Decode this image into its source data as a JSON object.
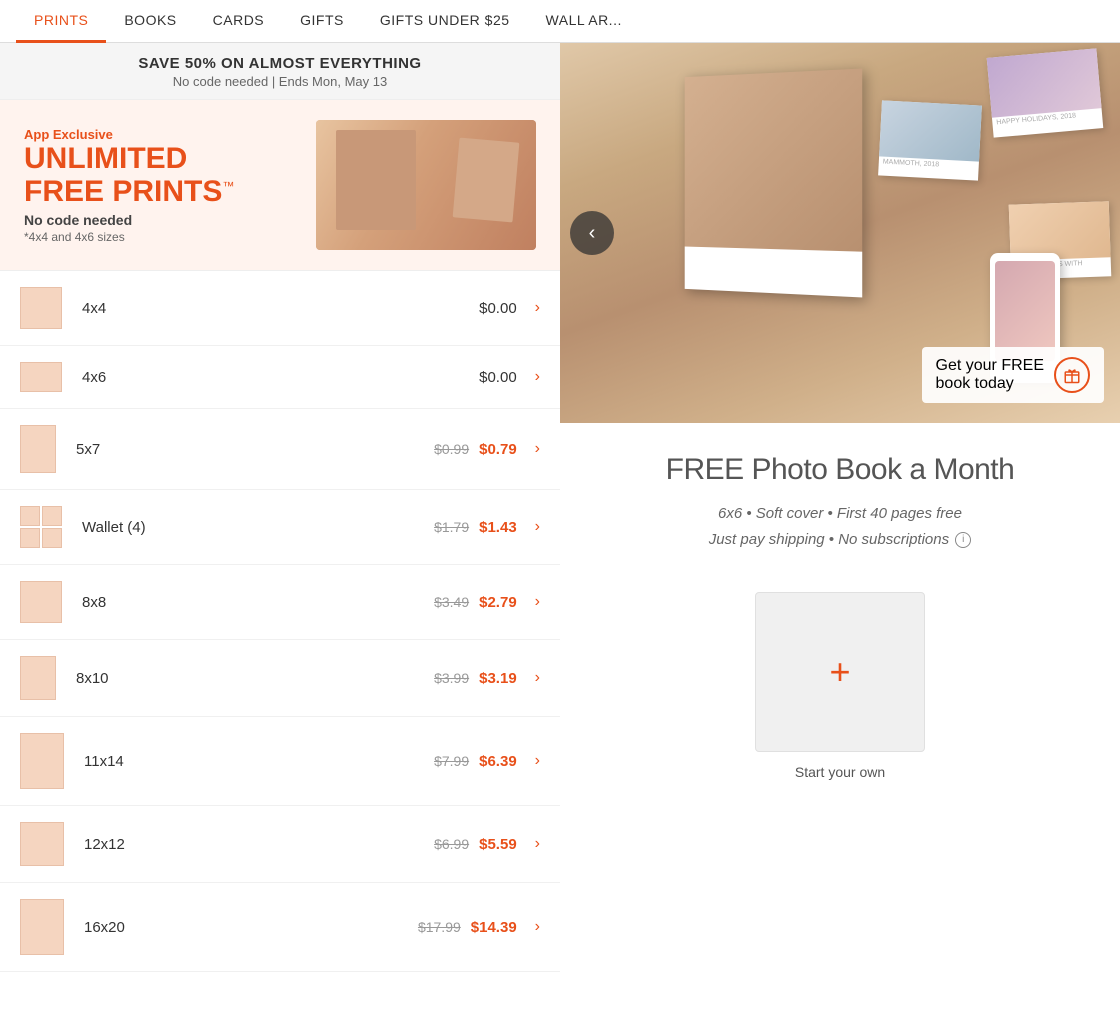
{
  "nav": {
    "items": [
      {
        "label": "PRINTS",
        "active": true
      },
      {
        "label": "BOOKS",
        "active": false
      },
      {
        "label": "CARDS",
        "active": false
      },
      {
        "label": "GIFTS",
        "active": false
      },
      {
        "label": "GIFTS UNDER $25",
        "active": false
      },
      {
        "label": "WALL AR...",
        "active": false
      }
    ]
  },
  "promo_banner": {
    "title": "SAVE 50% ON ALMOST EVERYTHING",
    "subtitle": "No code needed | Ends Mon, May 13"
  },
  "app_banner": {
    "exclusive_label": "App Exclusive",
    "headline_line1": "UNLIMITED",
    "headline_line2": "FREE PRINTS",
    "trademark": "™",
    "subtext": "No code needed",
    "note": "*4x4 and 4x6 sizes"
  },
  "prints": [
    {
      "size": "4x4",
      "orig": null,
      "sale": "$0.00",
      "is_free": true,
      "thumb_type": "4x4"
    },
    {
      "size": "4x6",
      "orig": null,
      "sale": "$0.00",
      "is_free": true,
      "thumb_type": "4x6"
    },
    {
      "size": "5x7",
      "orig": "$0.99",
      "sale": "$0.79",
      "is_free": false,
      "thumb_type": "5x7"
    },
    {
      "size": "Wallet (4)",
      "orig": "$1.79",
      "sale": "$1.43",
      "is_free": false,
      "thumb_type": "wallet"
    },
    {
      "size": "8x8",
      "orig": "$3.49",
      "sale": "$2.79",
      "is_free": false,
      "thumb_type": "8x8"
    },
    {
      "size": "8x10",
      "orig": "$3.99",
      "sale": "$3.19",
      "is_free": false,
      "thumb_type": "8x10"
    },
    {
      "size": "11x14",
      "orig": "$7.99",
      "sale": "$6.39",
      "is_free": false,
      "thumb_type": "11x14"
    },
    {
      "size": "12x12",
      "orig": "$6.99",
      "sale": "$5.59",
      "is_free": false,
      "thumb_type": "12x12"
    },
    {
      "size": "16x20",
      "orig": "$17.99",
      "sale": "$14.39",
      "is_free": false,
      "thumb_type": "16x20"
    }
  ],
  "right": {
    "back_btn_symbol": "‹",
    "free_book_cta_text_line1": "Get your FREE",
    "free_book_cta_text_line2": "book today",
    "promo_headline": "FREE Photo Book a Month",
    "promo_detail_line1": "6x6 • Soft cover • First 40 pages free",
    "promo_detail_line2": "Just pay shipping • No subscriptions",
    "plus_symbol": "+",
    "start_own_label": "Start your own"
  }
}
